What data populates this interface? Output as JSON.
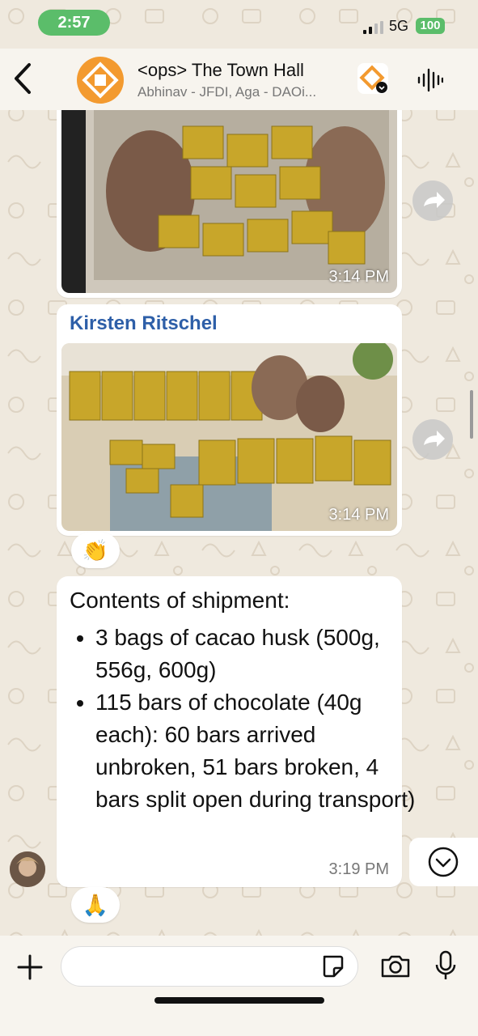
{
  "status_bar": {
    "time": "2:57",
    "network": "5G",
    "battery": "100"
  },
  "header": {
    "title": "<ops> The Town Hall",
    "subtitle": "Abhinav - JFDI, Aga - DAOi..."
  },
  "messages": [
    {
      "type": "photo",
      "timestamp": "3:14 PM",
      "description_icon": "photo-box-of-chocolate-bars"
    },
    {
      "type": "photo",
      "sender": "Kirsten Ritschel",
      "timestamp": "3:14 PM",
      "reaction": "👏"
    },
    {
      "type": "text",
      "title": "Contents of shipment:",
      "items": [
        "3 bags of cacao husk (500g, 556g, 600g)",
        "115 bars of chocolate (40g each): 60 bars arrived unbroken, 51 bars broken, 4 bars split open during transport)"
      ],
      "timestamp": "3:19 PM",
      "reaction": "🙏"
    }
  ],
  "icons": [
    "back-icon",
    "forward-icon",
    "waveform-icon",
    "plus-icon",
    "sticker-icon",
    "camera-icon",
    "mic-icon",
    "chevron-down-icon"
  ],
  "colors": {
    "accent_green": "#5bbd6a",
    "sender_blue": "#2e5fa8",
    "group_orange": "#f39a2f",
    "wallpaper": "#efe9de"
  }
}
